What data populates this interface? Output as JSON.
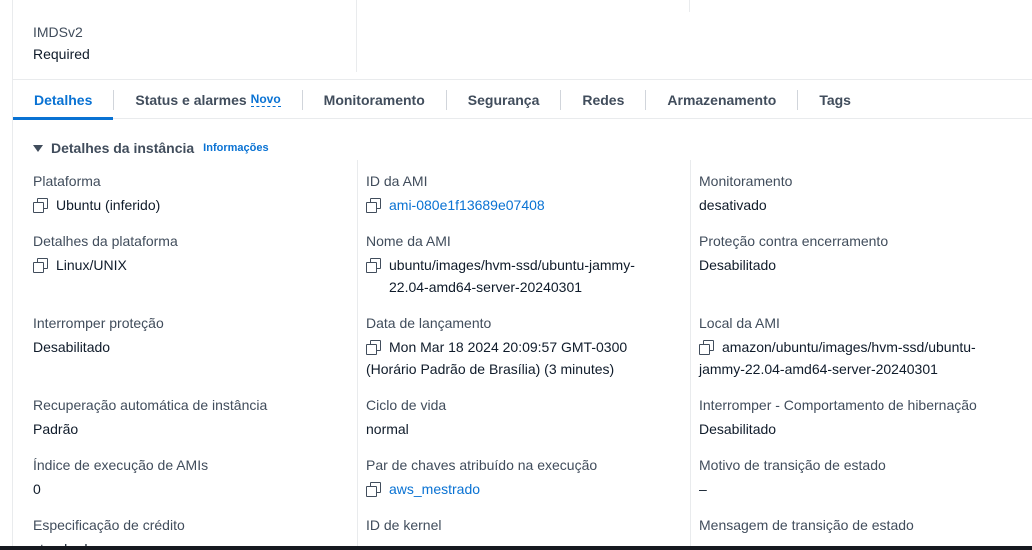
{
  "top": {
    "label": "IMDSv2",
    "value": "Required"
  },
  "tabs": [
    {
      "label": "Detalhes",
      "active": true
    },
    {
      "label": "Status e alarmes",
      "badge": "Novo"
    },
    {
      "label": "Monitoramento"
    },
    {
      "label": "Segurança"
    },
    {
      "label": "Redes"
    },
    {
      "label": "Armazenamento"
    },
    {
      "label": "Tags"
    }
  ],
  "section": {
    "title": "Detalhes da instância",
    "info": "Informações"
  },
  "fields": {
    "plataforma": {
      "label": "Plataforma",
      "value": "Ubuntu (inferido)"
    },
    "ami_id": {
      "label": "ID da AMI",
      "value": "ami-080e1f13689e07408"
    },
    "monitoramento": {
      "label": "Monitoramento",
      "value": "desativado"
    },
    "detalhes_plataforma": {
      "label": "Detalhes da plataforma",
      "value": "Linux/UNIX"
    },
    "nome_ami": {
      "label": "Nome da AMI",
      "value": "ubuntu/images/hvm-ssd/ubuntu-jammy-\n22.04-amd64-server-20240301"
    },
    "protecao_encerramento": {
      "label": "Proteção contra encerramento",
      "value": "Desabilitado"
    },
    "interromper_protecao": {
      "label": "Interromper proteção",
      "value": "Desabilitado"
    },
    "data_lancamento": {
      "label": "Data de lançamento",
      "value": "Mon Mar 18 2024 20:09:57 GMT-0300\n(Horário Padrão de Brasília) (3 minutes)"
    },
    "local_ami": {
      "label": "Local da AMI",
      "value": "amazon/ubuntu/images/hvm-ssd/ubuntu-\njammy-22.04-amd64-server-20240301"
    },
    "recuperacao": {
      "label": "Recuperação automática de instância",
      "value": "Padrão"
    },
    "ciclo_vida": {
      "label": "Ciclo de vida",
      "value": "normal"
    },
    "hibernacao": {
      "label": "Interromper - Comportamento de hibernação",
      "value": "Desabilitado"
    },
    "indice_ami": {
      "label": "Índice de execução de AMIs",
      "value": "0"
    },
    "par_chaves": {
      "label": "Par de chaves atribuído na execução",
      "value": "aws_mestrado"
    },
    "motivo_transicao": {
      "label": "Motivo de transição de estado",
      "value": "–"
    },
    "credito": {
      "label": "Especificação de crédito",
      "value": "standard"
    },
    "kernel": {
      "label": "ID de kernel",
      "value": ""
    },
    "mensagem_transicao": {
      "label": "Mensagem de transição de estado",
      "value": ""
    }
  },
  "colors": {
    "accent": "#0972d3",
    "label": "#414d5c",
    "text": "#0f1b2a",
    "divider": "#e9ebed"
  }
}
